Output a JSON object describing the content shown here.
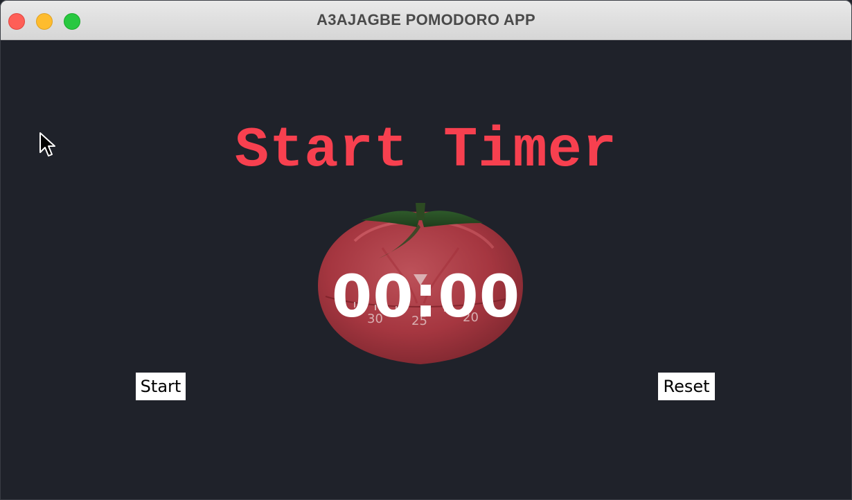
{
  "window": {
    "title": "A3AJAGBE POMODORO APP"
  },
  "main": {
    "heading": "Start Timer",
    "timer_display": "00:00",
    "dial_numbers": [
      "30",
      "25",
      "20"
    ],
    "start_button_label": "Start",
    "reset_button_label": "Reset"
  },
  "colors": {
    "background": "#1f222a",
    "heading": "#f7404f",
    "timer_text": "#ffffff",
    "tomato": "#c9424b"
  },
  "icons": [
    "close-icon",
    "minimize-icon",
    "maximize-icon",
    "tomato-timer-image",
    "mouse-pointer-icon"
  ]
}
